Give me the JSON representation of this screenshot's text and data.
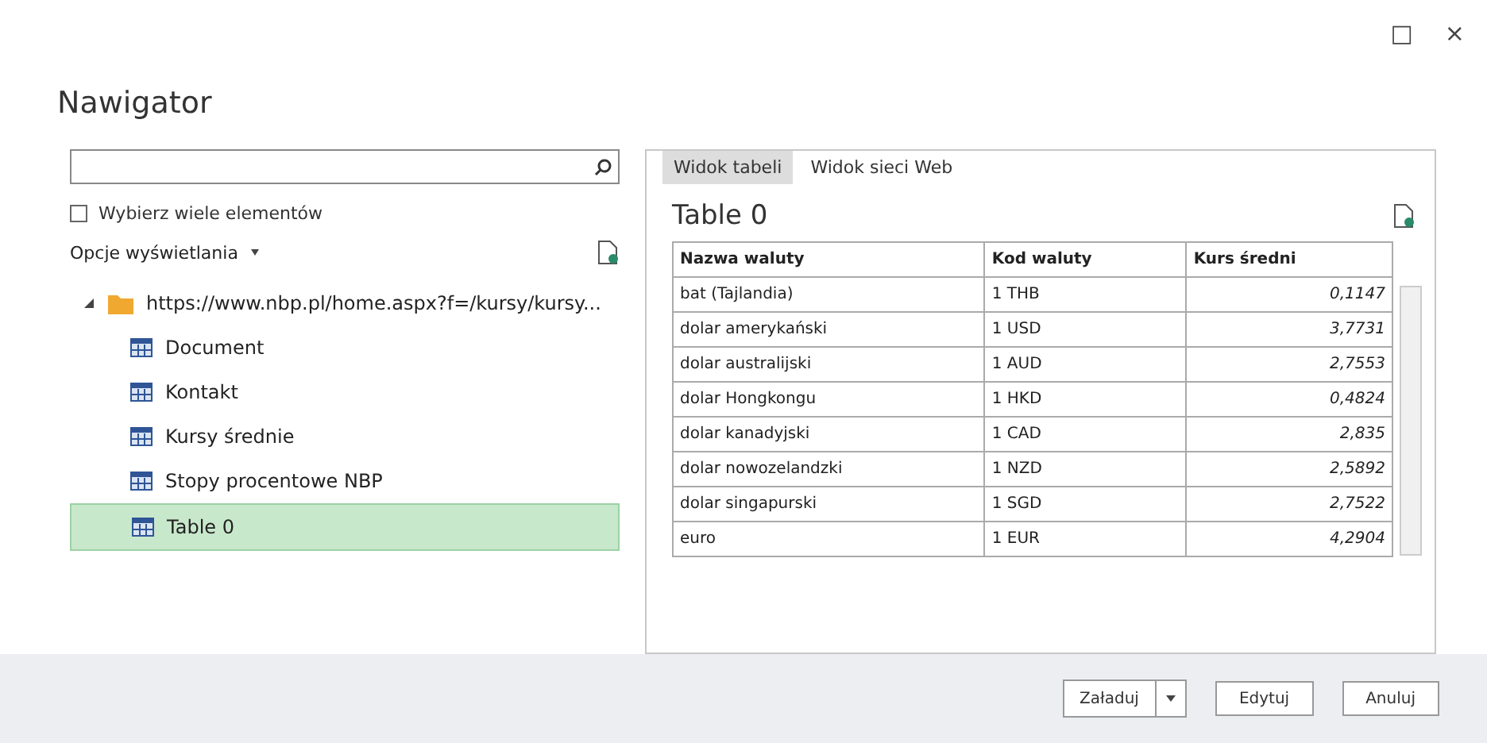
{
  "window": {
    "title": "Nawigator",
    "controls": [
      "□",
      "×"
    ]
  },
  "left": {
    "multi_select": {
      "label": "Wybierz wiele elementów",
      "checked": false
    },
    "display_options": "Opcje wyświetlania",
    "tree": [
      {
        "label": "https://www.nbp.pl/home.aspx?f=/kursy/kursy...",
        "kind": "folder",
        "expanded": true,
        "selected": false,
        "children": [
          {
            "label": "Document",
            "kind": "table",
            "selected": false
          },
          {
            "label": "Kontakt",
            "kind": "table",
            "selected": false
          },
          {
            "label": "Kursy średnie",
            "kind": "table",
            "selected": false
          },
          {
            "label": "Stopy procentowe NBP",
            "kind": "table",
            "selected": false
          },
          {
            "label": "Table 0",
            "kind": "table",
            "selected": true
          }
        ]
      }
    ]
  },
  "right": {
    "tabs": [
      {
        "label": "Widok tabeli",
        "selected": true
      },
      {
        "label": "Widok sieci Web",
        "selected": false
      }
    ],
    "preview_title": "Table 0",
    "table": {
      "columns": [
        "Nazwa waluty",
        "Kod waluty",
        "Kurs średni"
      ],
      "rows": [
        [
          "bat (Tajlandia)",
          "1 THB",
          "0,1147"
        ],
        [
          "dolar amerykański",
          "1 USD",
          "3,7731"
        ],
        [
          "dolar australijski",
          "1 AUD",
          "2,7553"
        ],
        [
          "dolar Hongkongu",
          "1 HKD",
          "0,4824"
        ],
        [
          "dolar kanadyjski",
          "1 CAD",
          "2,835"
        ],
        [
          "dolar nowozelandzki",
          "1 NZD",
          "2,5892"
        ],
        [
          "dolar singapurski",
          "1 SGD",
          "2,7522"
        ],
        [
          "euro",
          "1 EUR",
          "4,2904"
        ]
      ]
    }
  },
  "buttons": [
    {
      "label": "Załaduj",
      "kind": "split"
    },
    {
      "label": "Edytuj",
      "kind": "plain"
    },
    {
      "label": "Anuluj",
      "kind": "plain"
    }
  ]
}
